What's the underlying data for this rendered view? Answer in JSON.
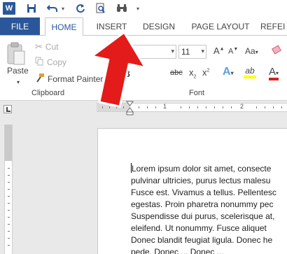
{
  "app": {
    "logo_letter": "W"
  },
  "qat": {
    "icons": [
      "word-logo",
      "save-icon",
      "undo-icon",
      "undo-dropdown-icon",
      "redo-icon",
      "print-preview-icon",
      "find-icon",
      "customize-qat-icon"
    ]
  },
  "tabs": {
    "file": "FILE",
    "home": "HOME",
    "insert": "INSERT",
    "design": "DESIGN",
    "page_layout": "PAGE LAYOUT",
    "references": "REFEI"
  },
  "clipboard": {
    "paste": "Paste",
    "cut": "Cut",
    "copy": "Copy",
    "format_painter": "Format Painter",
    "group_label": "Clipboard"
  },
  "font": {
    "font_size": "11",
    "group_label": "Font",
    "grow_font": "A",
    "shrink_font": "A",
    "change_case": "Aa",
    "bold": "B",
    "strikethrough": "abc",
    "subscript": "x",
    "superscript": "x",
    "text_effects": "A",
    "highlight": "ab",
    "font_color": "A"
  },
  "ruler": {
    "numbers": [
      "1",
      "2"
    ]
  },
  "document": {
    "lines": [
      "Lorem ipsum dolor sit amet, consecte",
      "pulvinar ultricies, purus lectus malesu",
      "Fusce est. Vivamus a tellus. Pellentesc",
      "egestas. Proin pharetra nonummy pec",
      "Suspendisse dui purus, scelerisque at,",
      "eleifend. Ut nonummy. Fusce aliquet",
      "Donec blandit feugiat ligula. Donec he",
      "pede. Donec ... Donec ..."
    ]
  },
  "colors": {
    "brand_blue": "#2b579a",
    "annotation_red": "#e31b1b",
    "highlight_yellow": "#ffff00",
    "font_color_red": "#d42121"
  }
}
